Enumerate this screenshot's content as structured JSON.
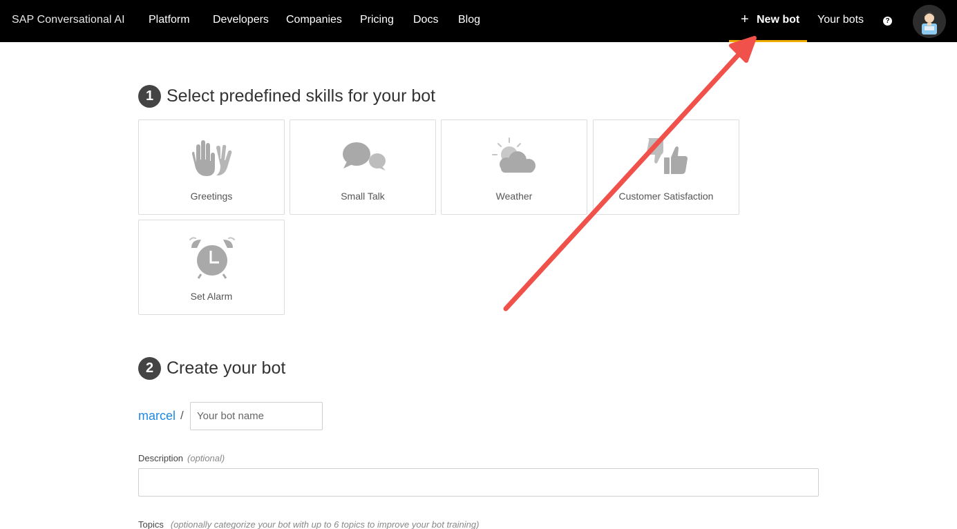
{
  "header": {
    "brand": "SAP Conversational AI",
    "nav": [
      "Platform",
      "Developers",
      "Companies",
      "Pricing",
      "Docs",
      "Blog"
    ],
    "new_bot_plus": "+",
    "new_bot_label": "New bot",
    "your_bots_label": "Your bots",
    "help_glyph": "?",
    "help_icon": "question-circle-icon",
    "avatar_icon": "user-avatar-icon",
    "accent_color": "#f0ab00"
  },
  "skills_section": {
    "step_number": "1",
    "title": "Select predefined skills for your bot",
    "skills": [
      {
        "label": "Greetings",
        "icon": "waving-hands-icon"
      },
      {
        "label": "Small Talk",
        "icon": "speech-bubbles-icon"
      },
      {
        "label": "Weather",
        "icon": "sun-cloud-icon"
      },
      {
        "label": "Customer Satisfaction",
        "icon": "thumbs-up-down-icon"
      },
      {
        "label": "Set Alarm",
        "icon": "alarm-clock-icon"
      }
    ]
  },
  "create_section": {
    "step_number": "2",
    "title": "Create your bot",
    "username": "marcel",
    "separator": "/",
    "bot_name_placeholder": "Your bot name",
    "bot_name_value": "",
    "description_label": "Description",
    "description_hint": "(optional)",
    "description_value": "",
    "topics_label": "Topics",
    "topics_hint": "(optionally categorize your bot with up to 6 topics to improve your bot training)"
  },
  "annotation": {
    "arrow_color": "#f0514a"
  }
}
